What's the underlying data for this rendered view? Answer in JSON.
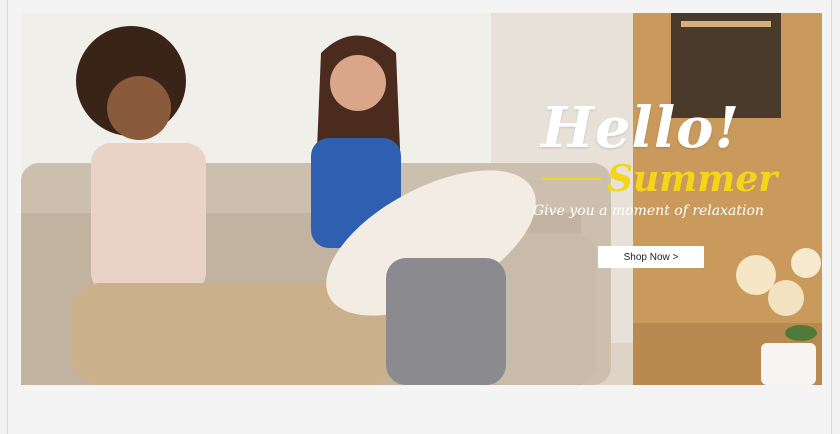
{
  "banner": {
    "headline": "Hello!",
    "subheadline": "Summer",
    "tagline": "Give you a moment of relaxation",
    "cta_label": "Shop Now >"
  },
  "colors": {
    "accent": "#f5d51a",
    "page_bg": "#f4f4f5"
  }
}
